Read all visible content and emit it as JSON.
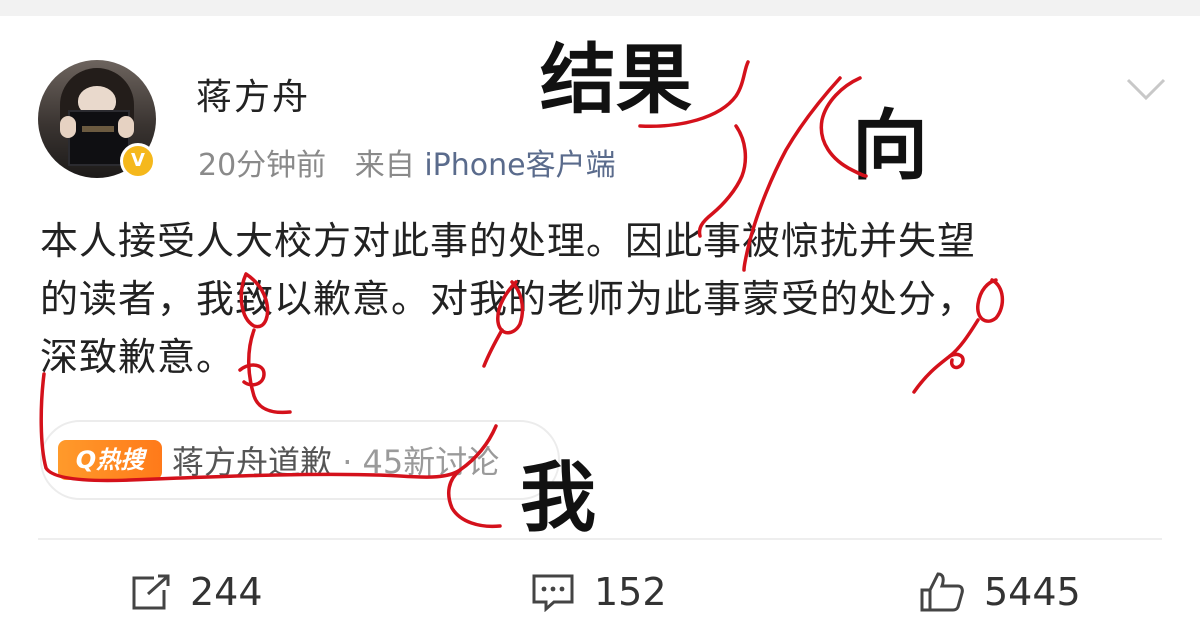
{
  "post": {
    "user_name": "蒋方舟",
    "timestamp": "20分钟前",
    "source_prefix": "来自",
    "source": "iPhone客户端",
    "verified_badge": "V",
    "text_line1": "本人接受人大校方对此事的处理。因此事被惊扰并失望",
    "text_line2": "的读者，我致以歉意。对我的老师为此事蒙受的处分，",
    "text_line3": "深致歉意。",
    "topic": {
      "badge": "Q热搜",
      "title": "蒋方舟道歉",
      "separator": "·",
      "count": "45新讨论"
    },
    "actions": {
      "repost_count": "244",
      "comment_count": "152",
      "like_count": "5445"
    }
  },
  "annotations": {
    "word1": "结果",
    "word2": "向",
    "word3": "我"
  },
  "colors": {
    "ink": "#d4111b",
    "badge": "#f5b81c",
    "hot": "#ff8a22",
    "link": "#5a6b8c"
  },
  "icons": [
    "chevron-down-icon",
    "repost-icon",
    "comment-icon",
    "like-icon",
    "verified-icon"
  ]
}
